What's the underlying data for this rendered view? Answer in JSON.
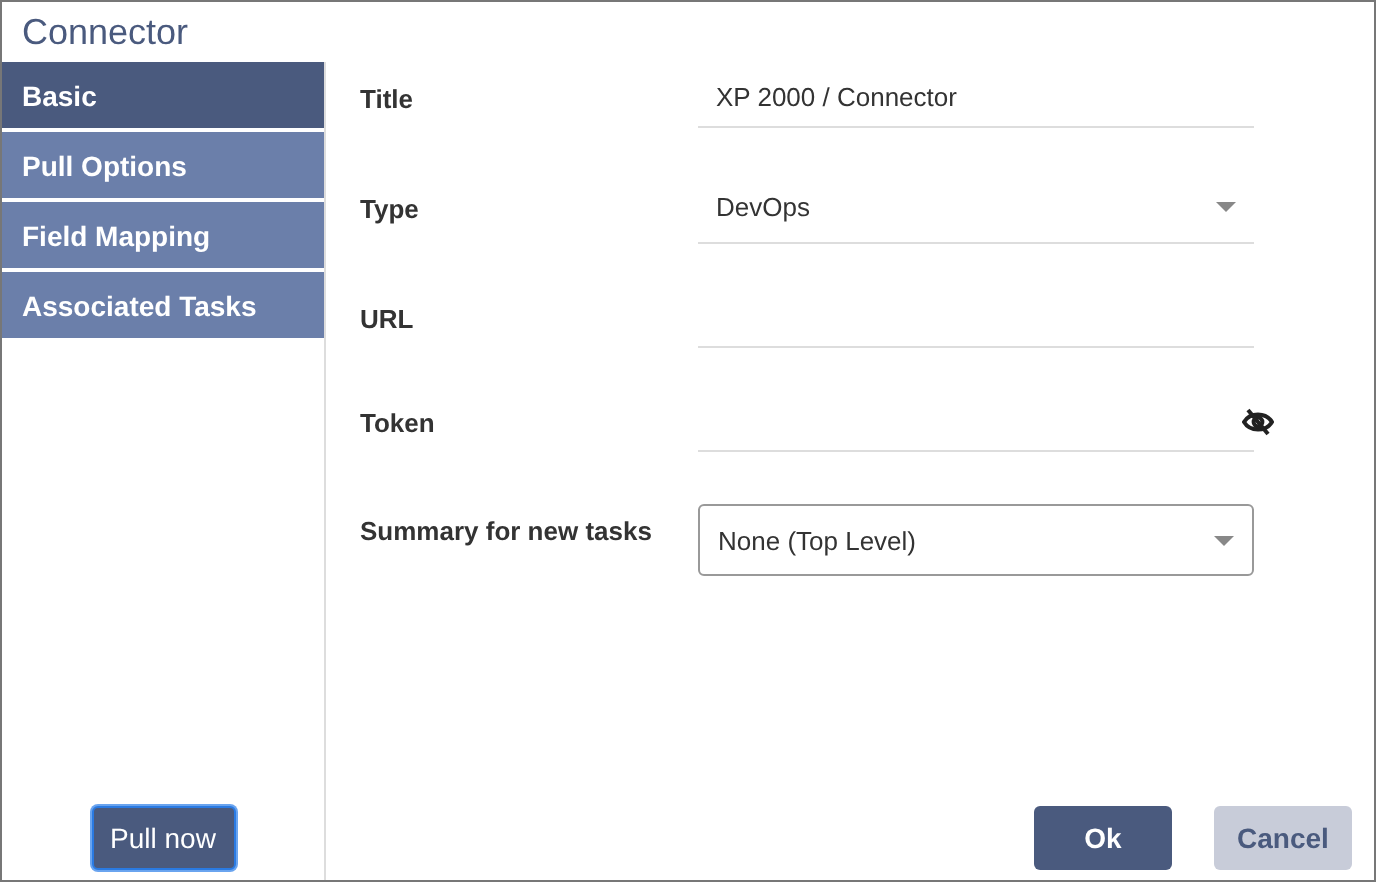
{
  "window": {
    "title": "Connector"
  },
  "sidebar": {
    "items": [
      {
        "label": "Basic",
        "selected": true
      },
      {
        "label": "Pull Options",
        "selected": false
      },
      {
        "label": "Field Mapping",
        "selected": false
      },
      {
        "label": "Associated Tasks",
        "selected": false
      }
    ],
    "button": {
      "label": "Pull now",
      "focused": true
    }
  },
  "form": {
    "fields": [
      {
        "kind": "text",
        "label": "Title",
        "value": "XP 2000 / Connector"
      },
      {
        "kind": "select",
        "label": "Type",
        "value": "DevOps"
      },
      {
        "kind": "text",
        "label": "URL"
      },
      {
        "kind": "password",
        "label": "Token"
      },
      {
        "kind": "outlined-select",
        "label": "Summary for new tasks",
        "value": "None (Top Level)"
      }
    ]
  },
  "buttons": [
    {
      "label": "Ok",
      "kind": "primary"
    },
    {
      "label": "Cancel",
      "kind": "secondary"
    }
  ]
}
